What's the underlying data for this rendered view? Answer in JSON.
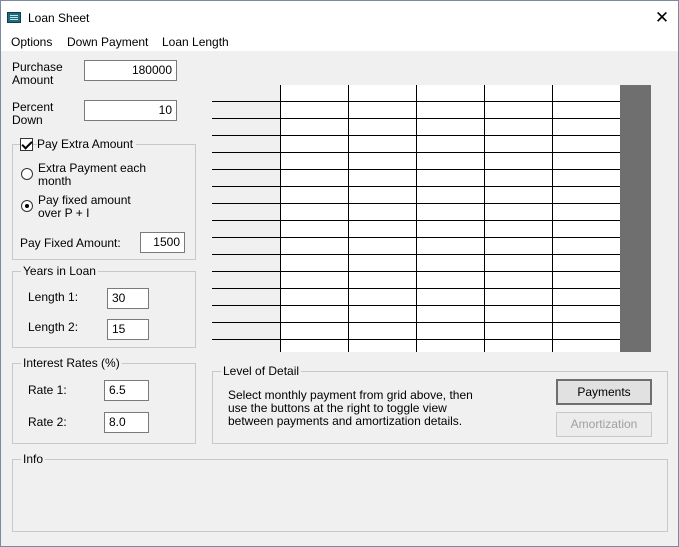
{
  "window": {
    "title": "Loan Sheet",
    "close_glyph": "✕"
  },
  "menu": [
    "Options",
    "Down Payment",
    "Loan Length"
  ],
  "purchase": {
    "label_line1": "Purchase",
    "label_line2": "Amount",
    "value": "180000"
  },
  "percent": {
    "label_line1": "Percent",
    "label_line2": "Down",
    "value": "10"
  },
  "extra": {
    "checkbox_label": "Pay Extra Amount",
    "checked": true,
    "opt1_line1": "Extra Payment each",
    "opt1_line2": "month",
    "opt2_line1": "Pay fixed amount",
    "opt2_line2": "over P + I",
    "selected_option": 2,
    "fixed_label": "Pay Fixed Amount:",
    "fixed_value": "1500"
  },
  "years": {
    "legend": "Years in Loan",
    "length1_label": "Length 1:",
    "length1_value": "30",
    "length2_label": "Length 2:",
    "length2_value": "15"
  },
  "rates": {
    "legend": "Interest Rates (%)",
    "rate1_label": "Rate 1:",
    "rate1_value": "6.5",
    "rate2_label": "Rate 2:",
    "rate2_value": "8.0"
  },
  "detail": {
    "legend": "Level of Detail",
    "text_line1": "Select monthly payment from grid above, then",
    "text_line2": "use the buttons at the right to toggle view",
    "text_line3": "between payments and amortization details.",
    "payments_button": "Payments",
    "amortization_button": "Amortization"
  },
  "info": {
    "legend": "Info"
  }
}
